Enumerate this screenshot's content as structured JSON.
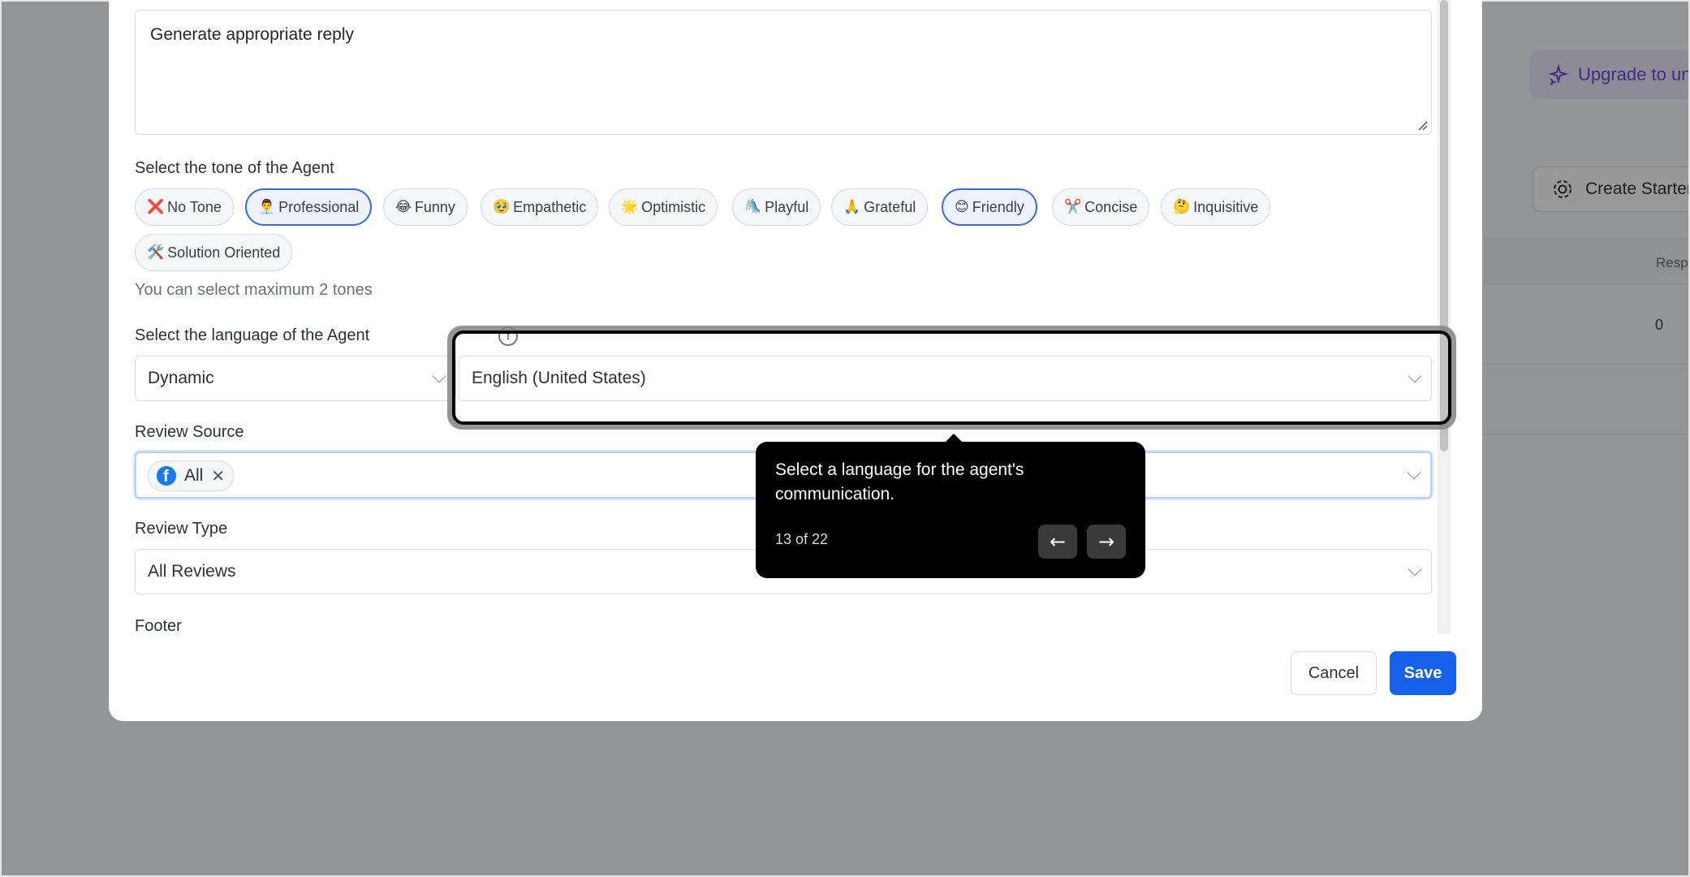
{
  "background": {
    "upgrade_label": "Upgrade to un",
    "create_label": "Create Starter",
    "column_header": "Resp",
    "row_value": "0"
  },
  "form": {
    "reply_text": "Generate appropriate reply",
    "tone_label": "Select the tone of the Agent",
    "tones": [
      {
        "emoji": "❌",
        "label": "No Tone"
      },
      {
        "emoji": "👨‍💼",
        "label": "Professional"
      },
      {
        "emoji": "😂",
        "label": "Funny"
      },
      {
        "emoji": "🥹",
        "label": "Empathetic"
      },
      {
        "emoji": "🌟",
        "label": "Optimistic"
      },
      {
        "emoji": "🛝",
        "label": "Playful"
      },
      {
        "emoji": "🙏",
        "label": "Grateful"
      },
      {
        "emoji": "😊",
        "label": "Friendly"
      },
      {
        "emoji": "✂️",
        "label": "Concise"
      },
      {
        "emoji": "🤔",
        "label": "Inquisitive"
      },
      {
        "emoji": "🛠️",
        "label": "Solution Oriented"
      }
    ],
    "tone_helper": "You can select maximum 2 tones",
    "language_label": "Select the language of the Agent",
    "language_mode": "Dynamic",
    "language_value": "English (United States)",
    "review_source_label": "Review Source",
    "review_source_tag": "All",
    "review_type_label": "Review Type",
    "review_type_value": "All Reviews",
    "footer_label": "Footer"
  },
  "actions": {
    "cancel": "Cancel",
    "save": "Save"
  },
  "tour": {
    "text": "Select a language for the agent's communication.",
    "step": "13 of 22",
    "prev_glyph": "←",
    "next_glyph": "→"
  }
}
